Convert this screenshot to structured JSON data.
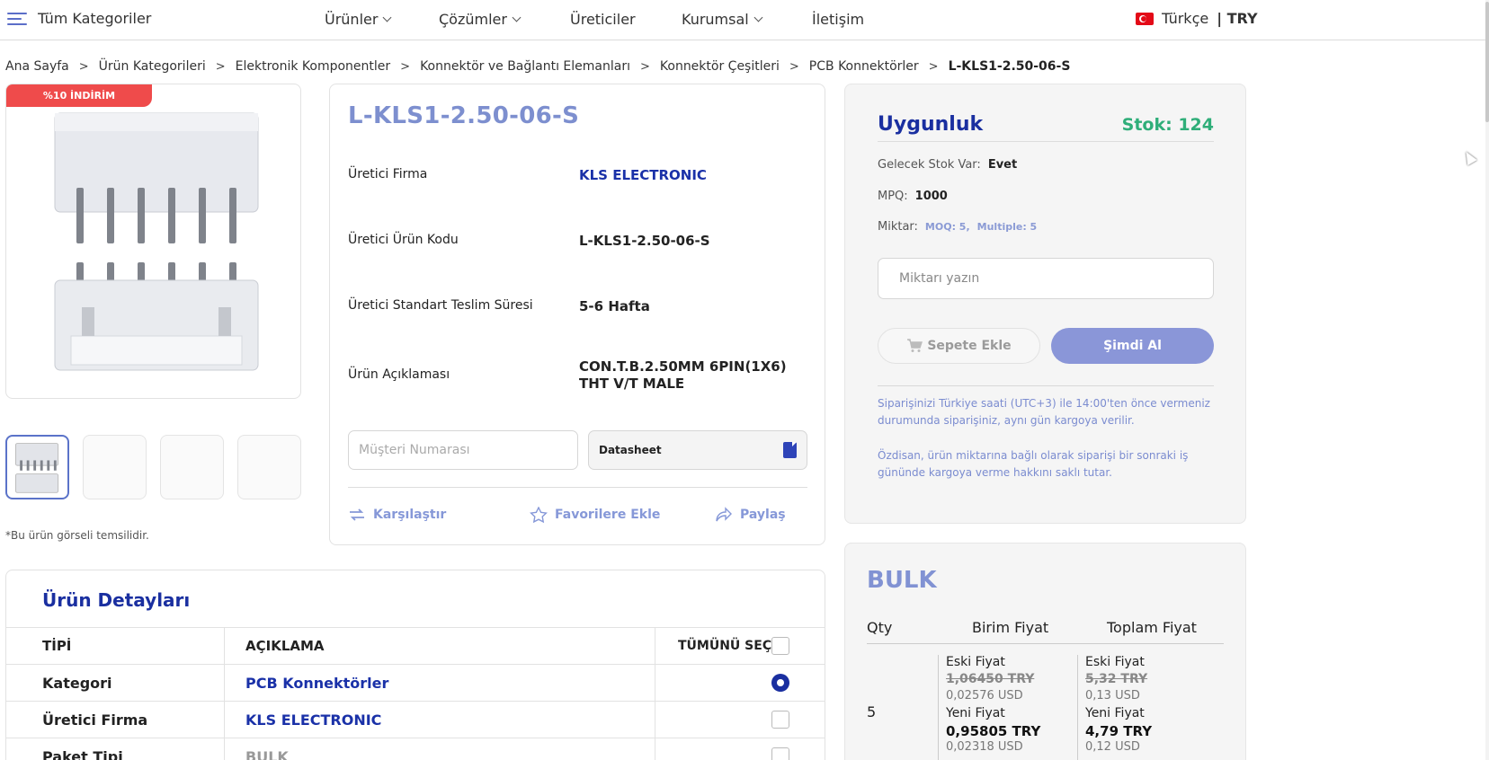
{
  "nav": {
    "all_categories": "Tüm Kategoriler",
    "menu": [
      {
        "label": "Ürünler",
        "dropdown": true
      },
      {
        "label": "Çözümler",
        "dropdown": true
      },
      {
        "label": "Üreticiler",
        "dropdown": false
      },
      {
        "label": "Kurumsal",
        "dropdown": true
      },
      {
        "label": "İletişim",
        "dropdown": false
      }
    ],
    "language": "Türkçe",
    "currency": "| TRY"
  },
  "breadcrumb": [
    "Ana Sayfa",
    "Ürün Kategorileri",
    "Elektronik Komponentler",
    "Konnektör ve Bağlantı Elemanları",
    "Konnektör Çeşitleri",
    "PCB Konnektörler",
    "L-KLS1-2.50-06-S"
  ],
  "gallery": {
    "badge": "%10 İNDİRİM",
    "note": "*Bu ürün görseli temsilidir."
  },
  "product": {
    "title": "L-KLS1-2.50-06-S",
    "specs": [
      {
        "key": "Üretici Firma",
        "value": "KLS ELECTRONIC"
      },
      {
        "key": "Üretici Ürün Kodu",
        "value": "L-KLS1-2.50-06-S"
      },
      {
        "key": "Üretici Standart Teslim Süresi",
        "value": "5-6 Hafta"
      },
      {
        "key": "Ürün Açıklaması",
        "value": "CON.T.B.2.50MM 6PIN(1X6) THT V/T MALE"
      }
    ],
    "customer_number_placeholder": "Müşteri Numarası",
    "datasheet": "Datasheet",
    "actions": {
      "compare": "Karşılaştır",
      "favorite": "Favorilere Ekle",
      "share": "Paylaş"
    }
  },
  "availability": {
    "title": "Uygunluk",
    "stock": "Stok: 124",
    "future_stock_label": "Gelecek Stok Var:",
    "future_stock_value": "Evet",
    "mpq_label": "MPQ:",
    "mpq_value": "1000",
    "quantity_label": "Miktar:",
    "moq": "MOQ: 5,",
    "multiple": "Multiple: 5",
    "quantity_placeholder": "Miktarı yazın",
    "add_to_cart": "Sepete Ekle",
    "buy_now": "Şimdi Al",
    "note1": "Siparişinizi Türkiye saati (UTC+3) ile 14:00'ten önce vermeniz durumunda siparişiniz, aynı gün kargoya verilir.",
    "note2": "Özdisan, ürün miktarına bağlı olarak siparişi bir sonraki iş gününde kargoya verme hakkını saklı tutar."
  },
  "bulk": {
    "title": "BULK",
    "headers": [
      "Qty",
      "Birim Fiyat",
      "Toplam Fiyat"
    ],
    "row": {
      "qty": "5",
      "unit": {
        "old_label": "Eski Fiyat",
        "old": "1,06450 TRY",
        "old_usd": "0,02576 USD",
        "new_label": "Yeni Fiyat",
        "new": "0,95805 TRY",
        "new_usd": "0,02318 USD"
      },
      "total": {
        "old_label": "Eski Fiyat",
        "old": "5,32 TRY",
        "old_usd": "0,13 USD",
        "new_label": "Yeni Fiyat",
        "new": "4,79 TRY",
        "new_usd": "0,12 USD"
      }
    }
  },
  "details": {
    "title": "Ürün Detayları",
    "headers": {
      "type": "TİPİ",
      "description": "AÇIKLAMA",
      "select_all": "TÜMÜNÜ SEÇ"
    },
    "rows": [
      {
        "type": "Kategori",
        "value": "PCB Konnektörler"
      },
      {
        "type": "Üretici Firma",
        "value": "KLS ELECTRONIC"
      },
      {
        "type": "Paket Tipi",
        "value": "BULK"
      }
    ]
  },
  "colors": {
    "primary": "#1a2fa0",
    "accent_light": "#8a96d8",
    "stock_green": "#2fae79",
    "discount_red": "#ef4b4b"
  }
}
